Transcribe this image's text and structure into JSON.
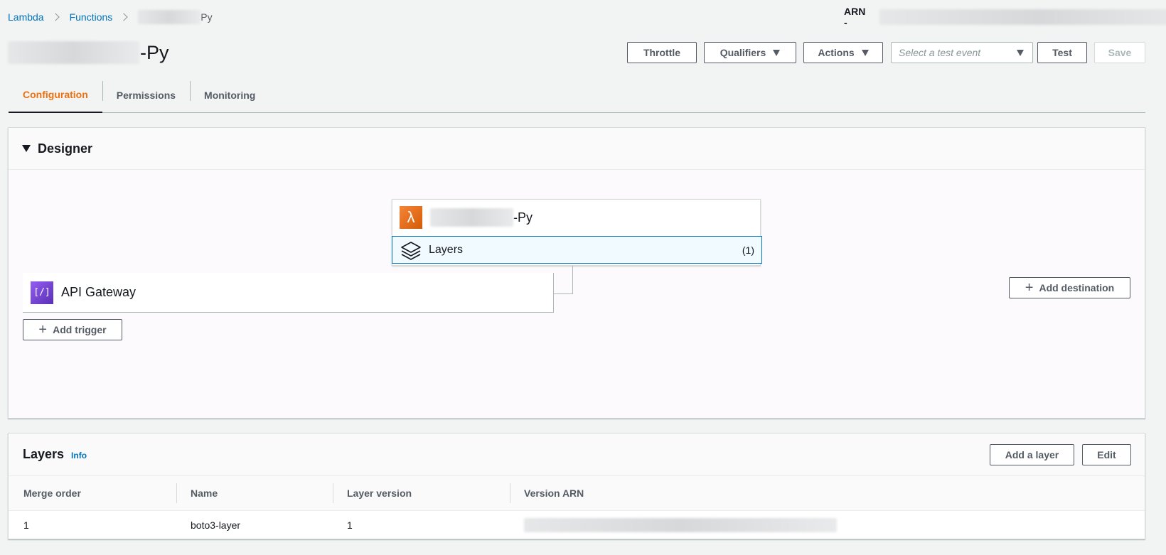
{
  "breadcrumb": {
    "items": [
      "Lambda",
      "Functions"
    ],
    "current_suffix": "Py"
  },
  "header": {
    "arn_label": "ARN -",
    "title_suffix": "-Py"
  },
  "toolbar": {
    "throttle": "Throttle",
    "qualifiers": "Qualifiers",
    "actions": "Actions",
    "test_event_placeholder": "Select a test event",
    "test": "Test",
    "save": "Save"
  },
  "tabs": [
    {
      "label": "Configuration",
      "active": true
    },
    {
      "label": "Permissions",
      "active": false
    },
    {
      "label": "Monitoring",
      "active": false
    }
  ],
  "designer": {
    "title": "Designer",
    "function_suffix": "-Py",
    "layers_label": "Layers",
    "layers_count": "(1)",
    "trigger_name": "API Gateway",
    "add_trigger": "Add trigger",
    "add_destination": "Add destination"
  },
  "layers_panel": {
    "title": "Layers",
    "info": "Info",
    "add_layer": "Add a layer",
    "edit": "Edit",
    "columns": [
      "Merge order",
      "Name",
      "Layer version",
      "Version ARN"
    ],
    "rows": [
      {
        "merge_order": "1",
        "name": "boto3-layer",
        "version": "1"
      }
    ]
  },
  "colors": {
    "accent": "#ec7211",
    "link": "#0073bb",
    "lambda": "#d45b07",
    "api_gateway": "#8c4fff"
  }
}
